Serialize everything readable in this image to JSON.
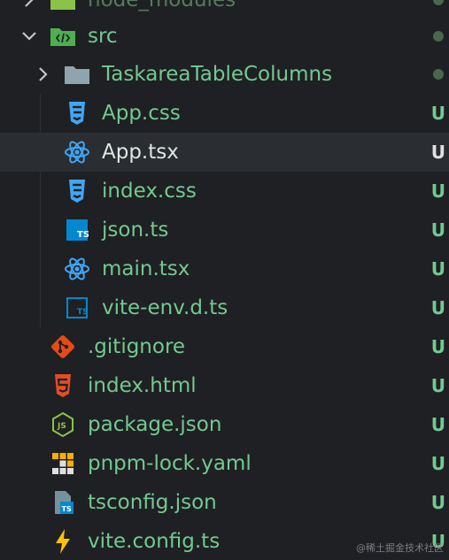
{
  "tree": {
    "partial_top": {
      "label": "node_modules"
    },
    "src_folder": {
      "label": "src"
    },
    "children": [
      {
        "label": "TaskareaTableColumns",
        "icon": "folder-icon",
        "status": "dot"
      },
      {
        "label": "App.css",
        "icon": "css-icon",
        "status": "U"
      },
      {
        "label": "App.tsx",
        "icon": "react-icon",
        "status": "U"
      },
      {
        "label": "index.css",
        "icon": "css-icon",
        "status": "U"
      },
      {
        "label": "json.ts",
        "icon": "typescript-icon",
        "status": "U"
      },
      {
        "label": "main.tsx",
        "icon": "react-icon",
        "status": "U"
      },
      {
        "label": "vite-env.d.ts",
        "icon": "typescript-def-icon",
        "status": "U"
      }
    ],
    "root_files": [
      {
        "label": ".gitignore",
        "icon": "git-icon",
        "status": "U"
      },
      {
        "label": "index.html",
        "icon": "html-icon",
        "status": "U"
      },
      {
        "label": "package.json",
        "icon": "nodejs-icon",
        "status": "U"
      },
      {
        "label": "pnpm-lock.yaml",
        "icon": "pnpm-icon",
        "status": "U"
      },
      {
        "label": "tsconfig.json",
        "icon": "tsconfig-icon",
        "status": "U"
      },
      {
        "label": "vite.config.ts",
        "icon": "vite-icon",
        "status": "U"
      }
    ]
  },
  "colors": {
    "background": "#1f2023",
    "selected_row": "#2a2d31",
    "untracked_text": "#73c991"
  },
  "watermark": "@稀土掘金技术社区"
}
